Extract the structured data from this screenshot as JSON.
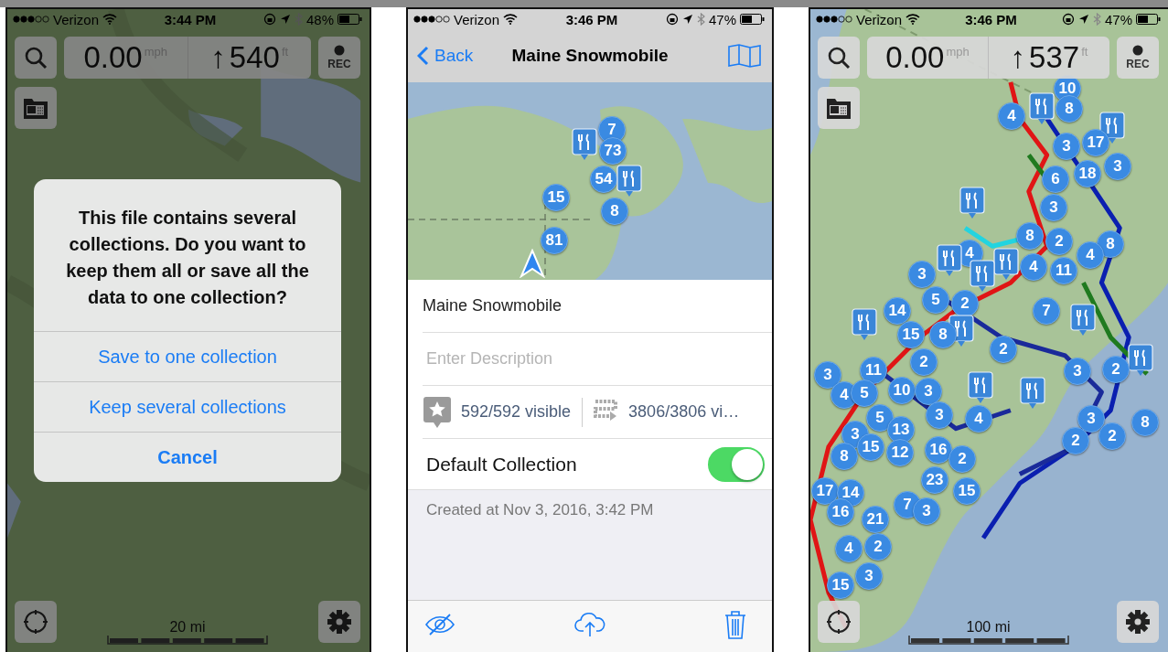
{
  "screens": [
    {
      "kind": "forest_map",
      "status_bar": {
        "carrier": "Verizon",
        "time": "3:44 PM",
        "battery": "48%"
      },
      "speed": {
        "value": "0.00",
        "unit": "mph"
      },
      "altitude": {
        "arrow": "↑",
        "value": "540",
        "unit": "ft"
      },
      "rec_label": "REC",
      "scale": "20 mi",
      "dialog": {
        "message": "This file contains several collections. Do you want to keep them all or save all the data to one collection?",
        "buttons": [
          {
            "label": "Save to one collection",
            "kind": "default"
          },
          {
            "label": "Keep several collections",
            "kind": "default"
          },
          {
            "label": "Cancel",
            "kind": "cancel"
          }
        ]
      }
    },
    {
      "kind": "detail",
      "status_bar": {
        "carrier": "Verizon",
        "time": "3:46 PM",
        "battery": "47%"
      },
      "nav": {
        "back": "Back",
        "title": "Maine Snowmobile"
      },
      "markers": [
        {
          "kind": "cluster",
          "label": "7"
        },
        {
          "kind": "food"
        },
        {
          "kind": "cluster",
          "label": "73"
        },
        {
          "kind": "cluster",
          "label": "54"
        },
        {
          "kind": "food"
        },
        {
          "kind": "cluster",
          "label": "15"
        },
        {
          "kind": "cluster",
          "label": "8"
        },
        {
          "kind": "cluster",
          "label": "81"
        }
      ],
      "name_value": "Maine Snowmobile",
      "description_placeholder": "Enter Description",
      "waypoints": "592/592 visible",
      "tracks": "3806/3806 vi…",
      "toggle": {
        "label": "Default Collection",
        "on": true
      },
      "created": "Created at Nov 3, 2016, 3:42 PM"
    },
    {
      "kind": "coast_map",
      "status_bar": {
        "carrier": "Verizon",
        "time": "3:46 PM",
        "battery": "47%"
      },
      "speed": {
        "value": "0.00",
        "unit": "mph"
      },
      "altitude": {
        "arrow": "↑",
        "value": "537",
        "unit": "ft"
      },
      "rec_label": "REC",
      "scale": "100 mi",
      "markers": [
        {
          "kind": "cluster",
          "label": "10"
        },
        {
          "kind": "cluster",
          "label": "4"
        },
        {
          "kind": "food"
        },
        {
          "kind": "cluster",
          "label": "8"
        },
        {
          "kind": "food"
        },
        {
          "kind": "cluster",
          "label": "3"
        },
        {
          "kind": "cluster",
          "label": "17"
        },
        {
          "kind": "cluster",
          "label": "6"
        },
        {
          "kind": "cluster",
          "label": "18"
        },
        {
          "kind": "cluster",
          "label": "3"
        },
        {
          "kind": "food"
        },
        {
          "kind": "cluster",
          "label": "3"
        },
        {
          "kind": "cluster",
          "label": "4"
        },
        {
          "kind": "cluster",
          "label": "8"
        },
        {
          "kind": "cluster",
          "label": "2"
        },
        {
          "kind": "cluster",
          "label": "8"
        },
        {
          "kind": "food"
        },
        {
          "kind": "food"
        },
        {
          "kind": "cluster",
          "label": "4"
        },
        {
          "kind": "cluster",
          "label": "11"
        },
        {
          "kind": "cluster",
          "label": "4"
        },
        {
          "kind": "cluster",
          "label": "3"
        },
        {
          "kind": "food"
        },
        {
          "kind": "cluster",
          "label": "14"
        },
        {
          "kind": "cluster",
          "label": "5"
        },
        {
          "kind": "cluster",
          "label": "2"
        },
        {
          "kind": "cluster",
          "label": "7"
        },
        {
          "kind": "food"
        },
        {
          "kind": "food"
        },
        {
          "kind": "food"
        },
        {
          "kind": "cluster",
          "label": "15"
        },
        {
          "kind": "cluster",
          "label": "8"
        },
        {
          "kind": "cluster",
          "label": "2"
        },
        {
          "kind": "cluster",
          "label": "2"
        },
        {
          "kind": "food"
        },
        {
          "kind": "cluster",
          "label": "3"
        },
        {
          "kind": "cluster",
          "label": "11"
        },
        {
          "kind": "cluster",
          "label": "3"
        },
        {
          "kind": "cluster",
          "label": "2"
        },
        {
          "kind": "cluster",
          "label": "4"
        },
        {
          "kind": "cluster",
          "label": "5"
        },
        {
          "kind": "cluster",
          "label": "10"
        },
        {
          "kind": "cluster",
          "label": "3"
        },
        {
          "kind": "food"
        },
        {
          "kind": "food"
        },
        {
          "kind": "cluster",
          "label": "5"
        },
        {
          "kind": "cluster",
          "label": "3"
        },
        {
          "kind": "cluster",
          "label": "4"
        },
        {
          "kind": "cluster",
          "label": "3"
        },
        {
          "kind": "cluster",
          "label": "8"
        },
        {
          "kind": "cluster",
          "label": "3"
        },
        {
          "kind": "cluster",
          "label": "13"
        },
        {
          "kind": "cluster",
          "label": "2"
        },
        {
          "kind": "cluster",
          "label": "2"
        },
        {
          "kind": "cluster",
          "label": "8"
        },
        {
          "kind": "cluster",
          "label": "15"
        },
        {
          "kind": "cluster",
          "label": "12"
        },
        {
          "kind": "cluster",
          "label": "16"
        },
        {
          "kind": "cluster",
          "label": "2"
        },
        {
          "kind": "cluster",
          "label": "23"
        },
        {
          "kind": "cluster",
          "label": "17"
        },
        {
          "kind": "cluster",
          "label": "14"
        },
        {
          "kind": "cluster",
          "label": "15"
        },
        {
          "kind": "cluster",
          "label": "16"
        },
        {
          "kind": "cluster",
          "label": "7"
        },
        {
          "kind": "cluster",
          "label": "3"
        },
        {
          "kind": "cluster",
          "label": "21"
        },
        {
          "kind": "cluster",
          "label": "4"
        },
        {
          "kind": "cluster",
          "label": "2"
        },
        {
          "kind": "cluster",
          "label": "15"
        },
        {
          "kind": "cluster",
          "label": "3"
        }
      ]
    }
  ]
}
